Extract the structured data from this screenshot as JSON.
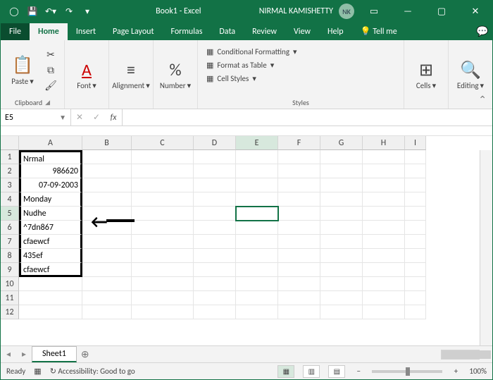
{
  "titlebar": {
    "autosave": "",
    "title": "Book1  -  Excel",
    "username": "NIRMAL KAMISHETTY",
    "initials": "NK"
  },
  "tabs": {
    "file": "File",
    "home": "Home",
    "insert": "Insert",
    "page_layout": "Page Layout",
    "formulas": "Formulas",
    "data": "Data",
    "review": "Review",
    "view": "View",
    "help": "Help",
    "tellme": "Tell me"
  },
  "ribbon": {
    "paste": "Paste",
    "clipboard": "Clipboard",
    "font": "Font",
    "alignment": "Alignment",
    "number": "Number",
    "cond_fmt": "Conditional Formatting",
    "fmt_table": "Format as Table",
    "cell_styles": "Cell Styles",
    "styles": "Styles",
    "cells": "Cells",
    "editing": "Editing"
  },
  "namebox": "E5",
  "columns": [
    "A",
    "B",
    "C",
    "D",
    "E",
    "F",
    "G",
    "H",
    "I"
  ],
  "rows": [
    "1",
    "2",
    "3",
    "4",
    "5",
    "6",
    "7",
    "8",
    "9",
    "10",
    "11",
    "12"
  ],
  "cells": {
    "A1": "Nrmal",
    "A2": "986620",
    "A3": "07-09-2003",
    "A4": "Monday",
    "A5": "Nudhe",
    "A6": "^7dn867",
    "A7": "cfaewcf",
    "A8": "435ef",
    "A9": "cfaewcf"
  },
  "selected_cell": "E5",
  "highlight_box": {
    "col": "A",
    "row_start": 1,
    "row_end": 9
  },
  "sheets": {
    "active": "Sheet1"
  },
  "statusbar": {
    "ready": "Ready",
    "accessibility": "Accessibility: Good to go",
    "zoom": "100%"
  }
}
